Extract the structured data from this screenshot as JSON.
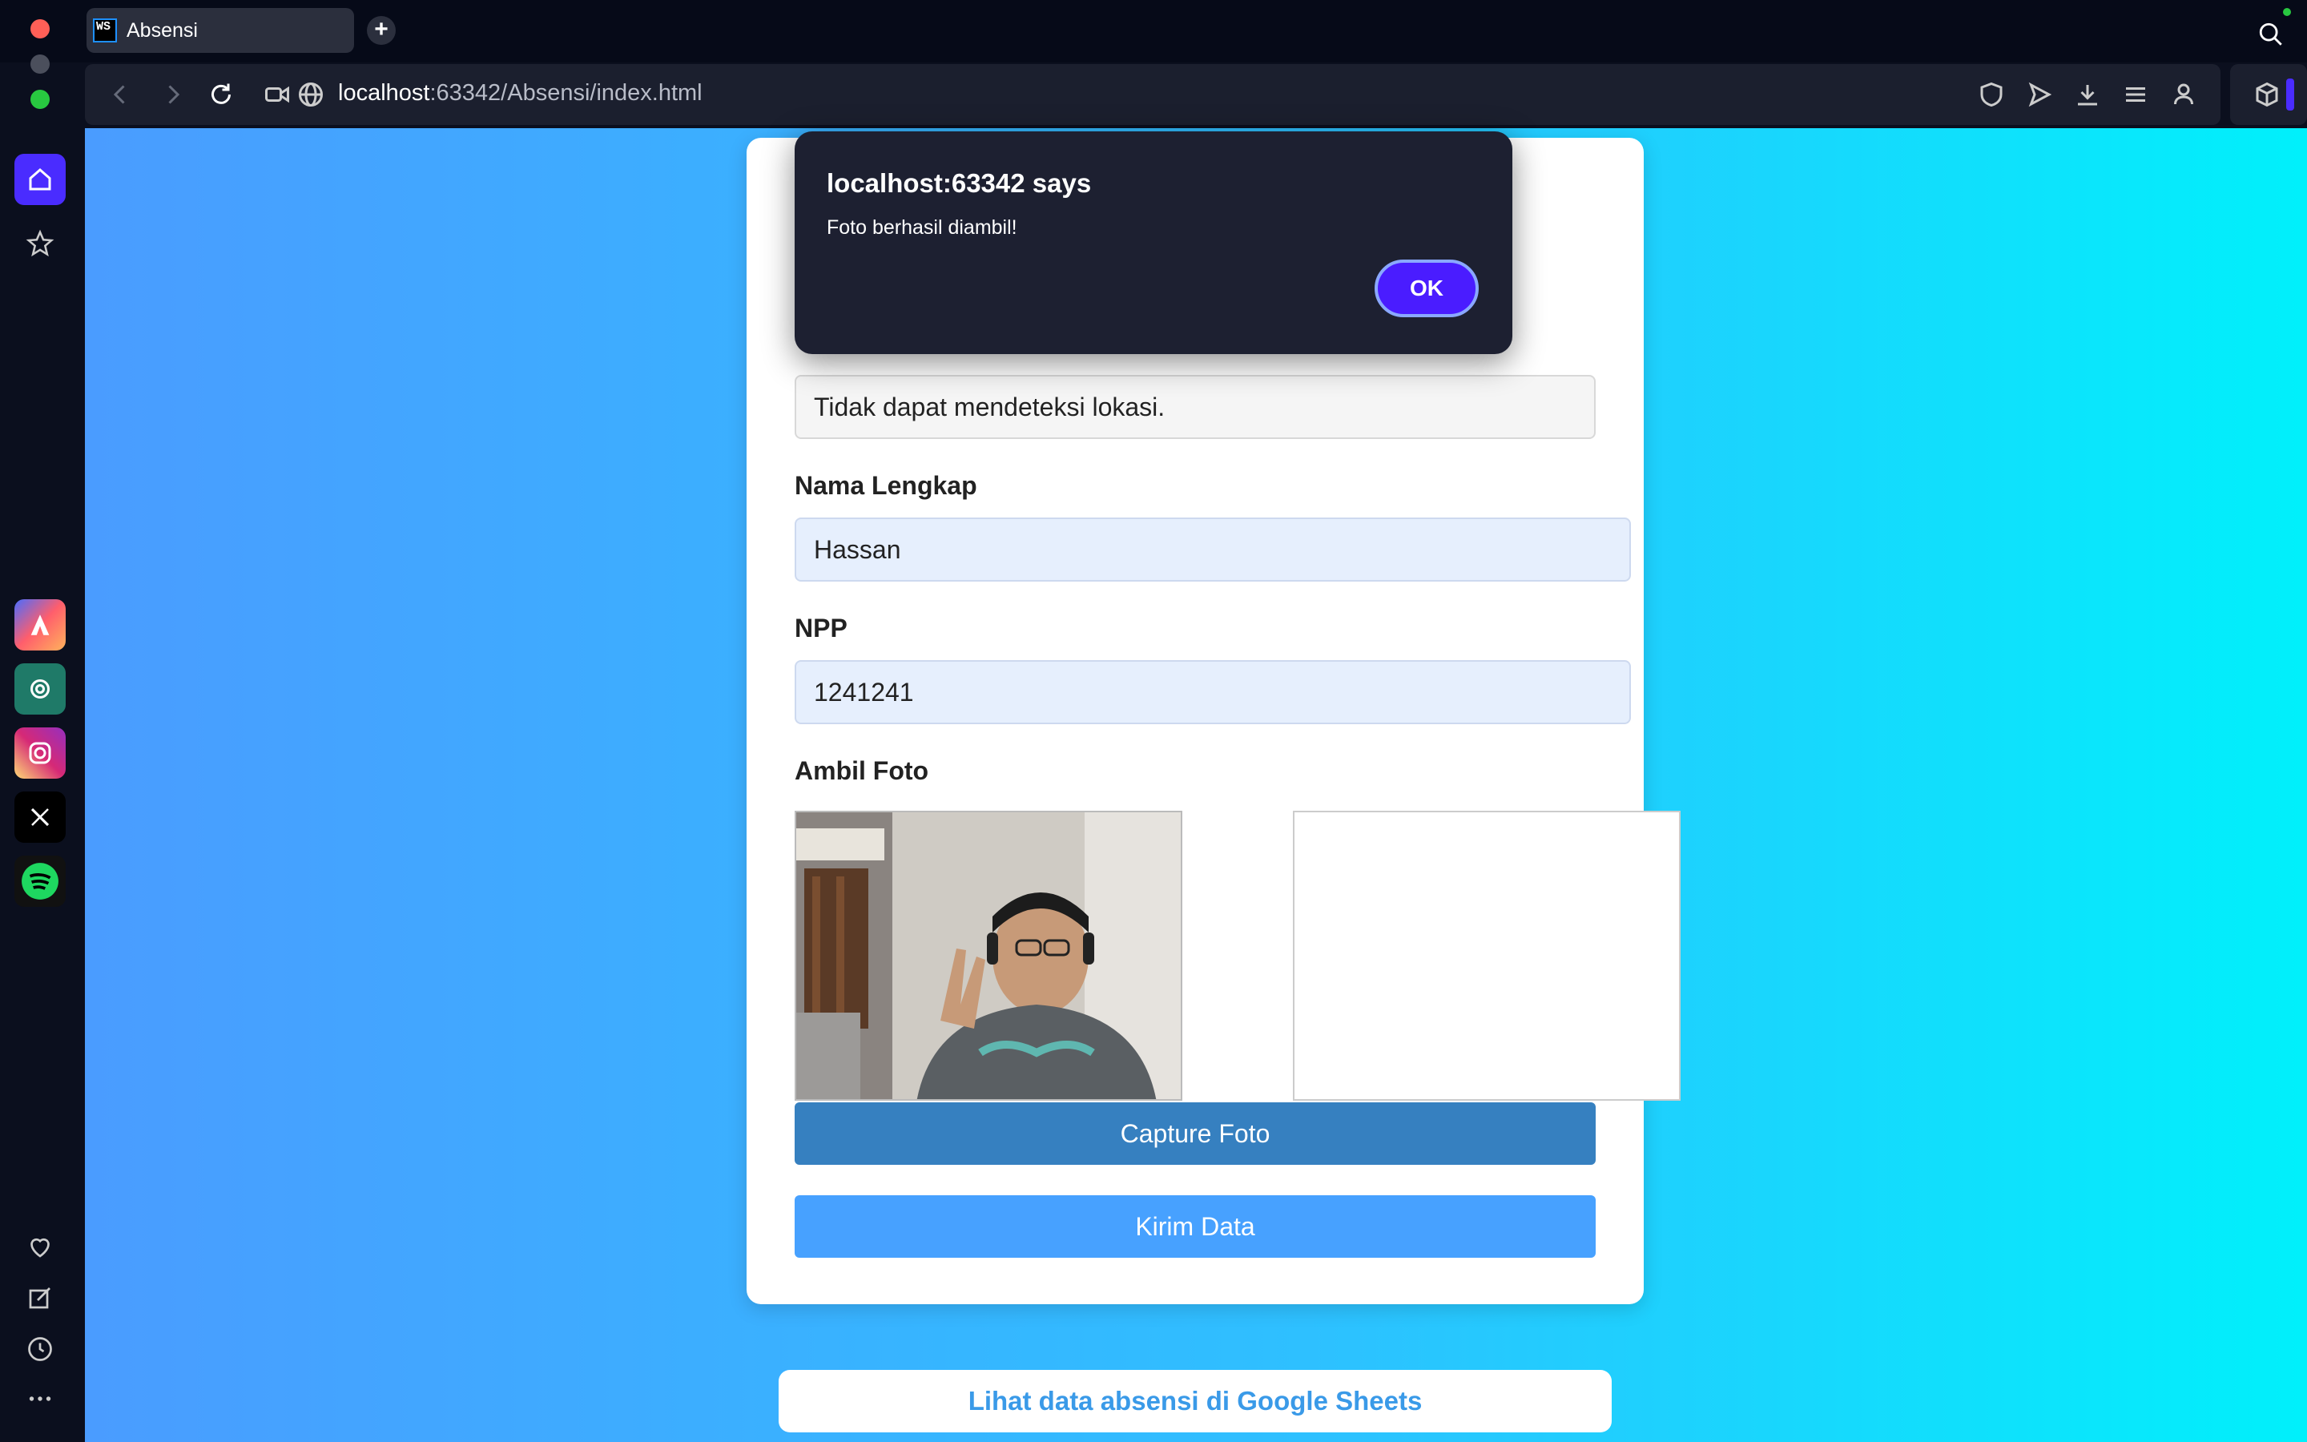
{
  "browser": {
    "tab_title": "Absensi",
    "tab_favicon": "WS",
    "url_host": "localhost",
    "url_rest": ":63342/Absensi/index.html"
  },
  "sidebar": {
    "apps": [
      "aria-icon",
      "chatgpt-icon",
      "instagram-icon",
      "x-icon",
      "spotify-icon"
    ]
  },
  "form": {
    "location_value": "Tidak dapat mendeteksi lokasi.",
    "name_label": "Nama Lengkap",
    "name_value": "Hassan",
    "npp_label": "NPP",
    "npp_value": "1241241",
    "photo_label": "Ambil Foto",
    "capture_label": "Capture Foto",
    "submit_label": "Kirim Data"
  },
  "link": {
    "sheets_label": "Lihat data absensi di Google Sheets"
  },
  "dialog": {
    "title": "localhost:63342 says",
    "message": "Foto berhasil diambil!",
    "ok_label": "OK"
  },
  "colors": {
    "accent": "#4a2cff",
    "capture_button": "#3680c0",
    "submit_button": "#47a1ff",
    "link_text": "#3a9ae8"
  }
}
